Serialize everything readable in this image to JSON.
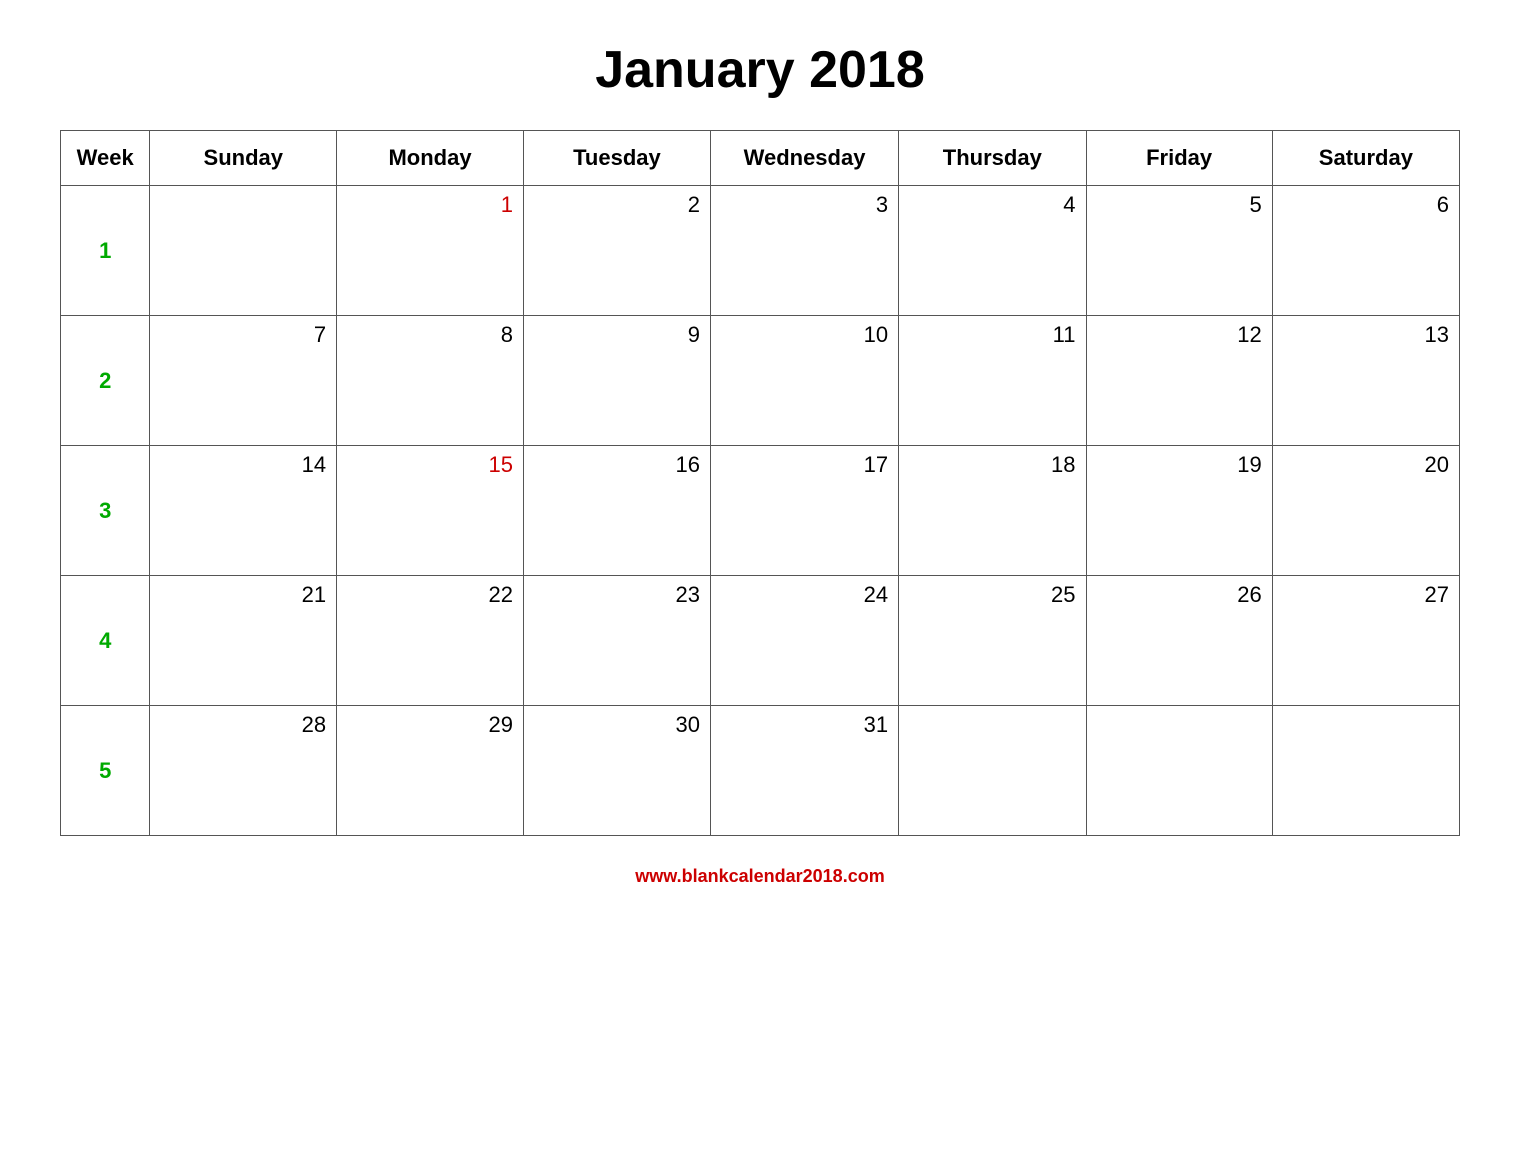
{
  "title": "January 2018",
  "footer_url": "www.blankcalendar2018.com",
  "headers": [
    "Week",
    "Sunday",
    "Monday",
    "Tuesday",
    "Wednesday",
    "Thursday",
    "Friday",
    "Saturday"
  ],
  "weeks": [
    {
      "week_num": "1",
      "days": [
        {
          "day": "",
          "empty": true
        },
        {
          "day": "1",
          "red": true
        },
        {
          "day": "2",
          "red": false
        },
        {
          "day": "3",
          "red": false
        },
        {
          "day": "4",
          "red": false
        },
        {
          "day": "5",
          "red": false
        },
        {
          "day": "6",
          "red": false
        }
      ]
    },
    {
      "week_num": "2",
      "days": [
        {
          "day": "7",
          "red": false
        },
        {
          "day": "8",
          "red": false
        },
        {
          "day": "9",
          "red": false
        },
        {
          "day": "10",
          "red": false
        },
        {
          "day": "11",
          "red": false
        },
        {
          "day": "12",
          "red": false
        },
        {
          "day": "13",
          "red": false
        }
      ]
    },
    {
      "week_num": "3",
      "days": [
        {
          "day": "14",
          "red": false
        },
        {
          "day": "15",
          "red": true
        },
        {
          "day": "16",
          "red": false
        },
        {
          "day": "17",
          "red": false
        },
        {
          "day": "18",
          "red": false
        },
        {
          "day": "19",
          "red": false
        },
        {
          "day": "20",
          "red": false
        }
      ]
    },
    {
      "week_num": "4",
      "days": [
        {
          "day": "21",
          "red": false
        },
        {
          "day": "22",
          "red": false
        },
        {
          "day": "23",
          "red": false
        },
        {
          "day": "24",
          "red": false
        },
        {
          "day": "25",
          "red": false
        },
        {
          "day": "26",
          "red": false
        },
        {
          "day": "27",
          "red": false
        }
      ]
    },
    {
      "week_num": "5",
      "days": [
        {
          "day": "28",
          "red": false
        },
        {
          "day": "29",
          "red": false
        },
        {
          "day": "30",
          "red": false
        },
        {
          "day": "31",
          "red": false
        },
        {
          "day": "",
          "empty": true
        },
        {
          "day": "",
          "empty": true
        },
        {
          "day": "",
          "empty": true
        }
      ]
    }
  ]
}
